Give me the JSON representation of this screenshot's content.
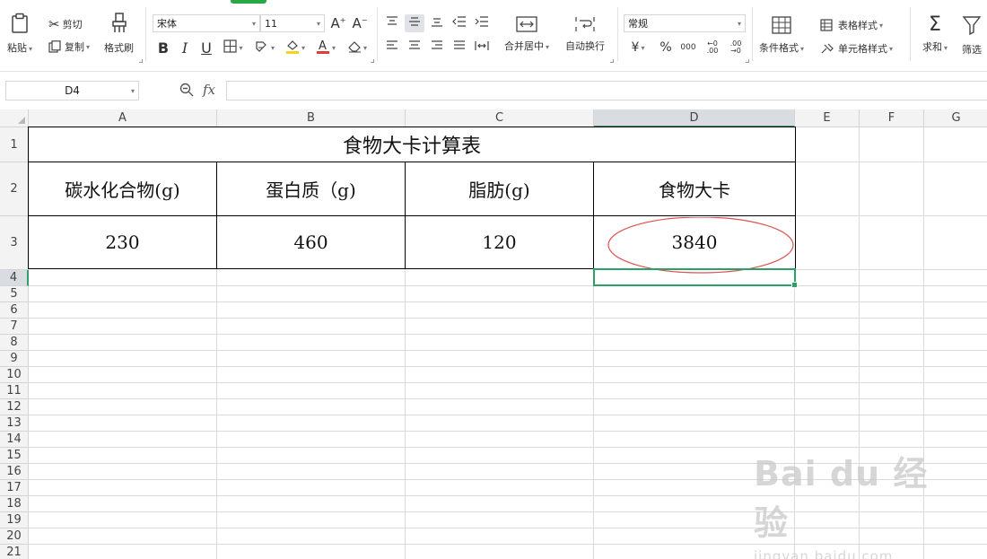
{
  "ribbon": {
    "paste_label": "粘贴",
    "cut_label": "剪切",
    "copy_label": "复制",
    "format_painter_label": "格式刷",
    "font_name": "宋体",
    "font_size": "11",
    "merge_center_label": "合并居中",
    "wrap_text_label": "自动换行",
    "number_format": "常规",
    "conditional_format_label": "条件格式",
    "table_style_label": "表格样式",
    "cell_style_label": "单元格样式",
    "sum_label": "求和",
    "filter_label": "筛选",
    "bold_glyph": "B",
    "italic_glyph": "I",
    "underline_glyph": "U",
    "currency_glyph": "¥",
    "percent_glyph": "%",
    "thousands_glyph": "000",
    "inc_decimal_glyph": "←0 .00",
    "dec_decimal_glyph": ".00 →0",
    "grow_font_glyph": "A",
    "shrink_font_glyph": "A"
  },
  "formula_bar": {
    "name_box": "D4",
    "fx_label": "fx",
    "formula": ""
  },
  "sheet": {
    "columns": [
      "A",
      "B",
      "C",
      "D",
      "E",
      "F",
      "G"
    ],
    "rows": [
      "1",
      "2",
      "3",
      "4",
      "5",
      "6",
      "7",
      "8",
      "9",
      "10",
      "11",
      "12",
      "13",
      "14",
      "15",
      "16",
      "17",
      "18",
      "19",
      "20",
      "21"
    ],
    "title": "食物大卡计算表",
    "headers": [
      "碳水化合物(g)",
      "蛋白质（g)",
      "脂肪(g)",
      "食物大卡"
    ],
    "values": [
      "230",
      "460",
      "120",
      "3840"
    ],
    "annotation_color": "#e05050",
    "selection_color": "#2ba069"
  },
  "watermark": {
    "brand": "Bai du 经验",
    "url": "jingyan.baidu.com"
  }
}
